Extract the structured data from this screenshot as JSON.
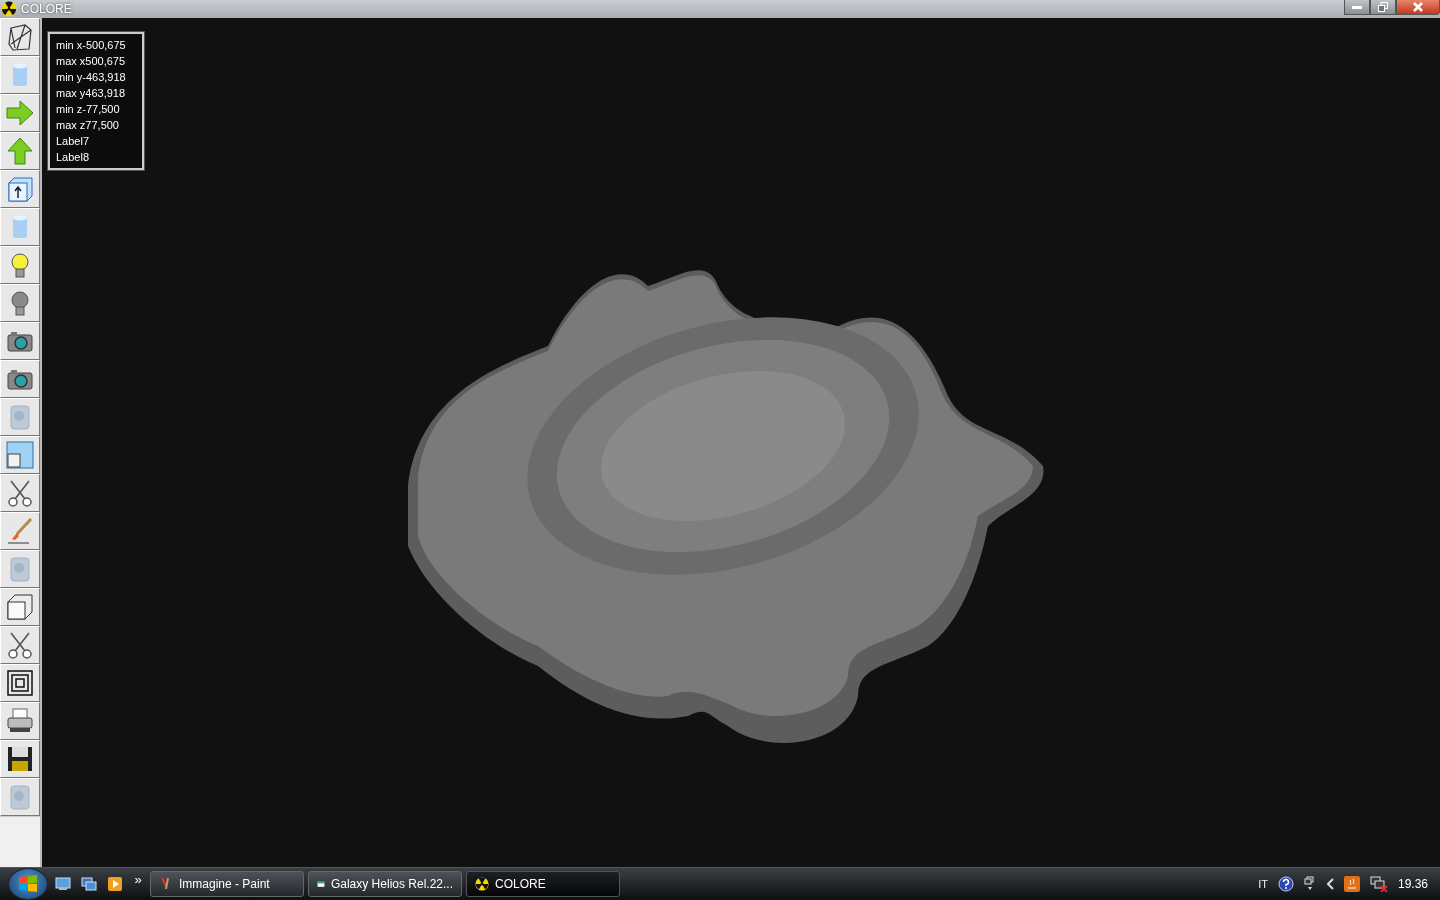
{
  "window": {
    "title": "COLORE"
  },
  "toolbar": {
    "buttons": [
      {
        "kind": "wireframe",
        "disabled": false
      },
      {
        "kind": "cylinder",
        "disabled": false
      },
      {
        "kind": "arrow-right",
        "disabled": false
      },
      {
        "kind": "arrow-up",
        "disabled": false
      },
      {
        "kind": "box-arrow",
        "disabled": false
      },
      {
        "kind": "cylinder",
        "disabled": false
      },
      {
        "kind": "bulb-on",
        "disabled": false
      },
      {
        "kind": "bulb-off",
        "disabled": false
      },
      {
        "kind": "camera",
        "disabled": false
      },
      {
        "kind": "camera",
        "disabled": false
      },
      {
        "kind": "texture",
        "disabled": true
      },
      {
        "kind": "window",
        "disabled": false
      },
      {
        "kind": "scissors",
        "disabled": false
      },
      {
        "kind": "brush",
        "disabled": false
      },
      {
        "kind": "texture",
        "disabled": true
      },
      {
        "kind": "cube",
        "disabled": false
      },
      {
        "kind": "scissors",
        "disabled": false
      },
      {
        "kind": "concentric",
        "disabled": false
      },
      {
        "kind": "printer",
        "disabled": false
      },
      {
        "kind": "floppy",
        "disabled": false
      },
      {
        "kind": "texture",
        "disabled": true
      }
    ]
  },
  "info_labels": [
    "min x-500,675",
    "max x500,675",
    "min y-463,918",
    "max y463,918",
    "min z-77,500",
    "max z77,500",
    "Label7",
    "Label8"
  ],
  "taskbar": {
    "quick_launch_more": "»",
    "tasks": [
      {
        "label": "Immagine - Paint",
        "kind": "paint",
        "selected": false
      },
      {
        "label": "Galaxy Helios  Rel.22...",
        "kind": "helios",
        "selected": false
      },
      {
        "label": "COLORE",
        "kind": "colore",
        "selected": true
      }
    ],
    "language": "IT",
    "clock": "19.36"
  }
}
